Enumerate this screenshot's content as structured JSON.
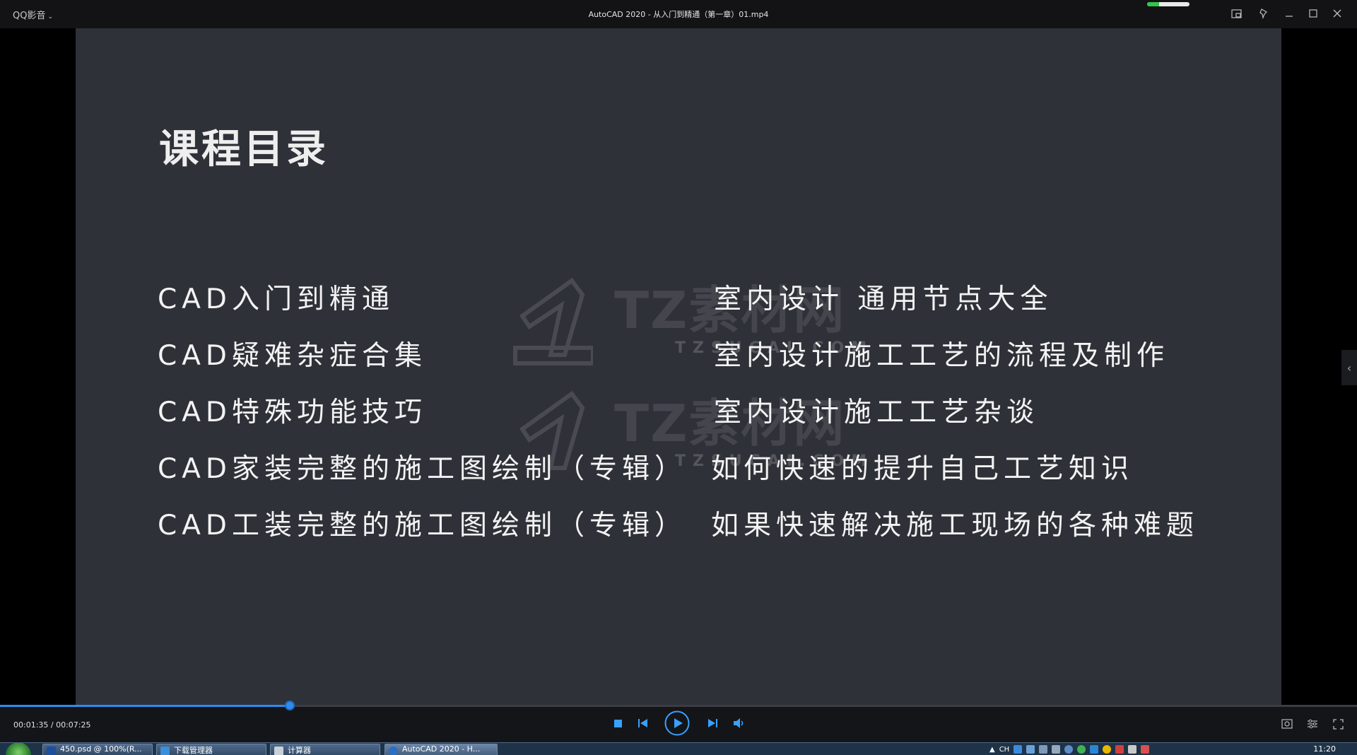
{
  "titlebar": {
    "app_menu": "QQ影音",
    "window_title": "AutoCAD 2020 - 从入门到精通（第一章）01.mp4",
    "loading_progress": 0.28
  },
  "slide": {
    "title": "课程目录",
    "left_column": [
      "CAD入门到精通",
      "CAD疑难杂症合集",
      "CAD特殊功能技巧",
      "CAD家装完整的施工图绘制（专辑）",
      "CAD工装完整的施工图绘制（专辑）"
    ],
    "right_column": [
      "室内设计 通用节点大全",
      "室内设计施工工艺的流程及制作",
      "室内设计施工工艺杂谈",
      "如何快速的提升自己工艺知识",
      "如果快速解决施工现场的各种难题"
    ],
    "watermark": {
      "brand": "TZ素材网",
      "domain": "TZSUCAI.COM"
    }
  },
  "player": {
    "time_display": "00:01:35 / 00:07:25",
    "position_fraction": 0.2135,
    "accent_color": "#2d8cf0"
  },
  "taskbar": {
    "tasks": [
      "450.psd @ 100%(R...",
      "下载管理器",
      "计算器",
      "AutoCAD 2020 - H..."
    ],
    "input_method": "CH",
    "clock": "11:20"
  }
}
